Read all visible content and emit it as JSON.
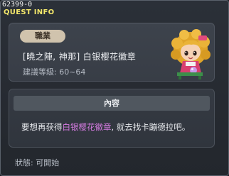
{
  "window": {
    "id_text": "62399-0",
    "title": "QUEST INFO"
  },
  "job": {
    "tag_label": "職業",
    "name": "[曉之陣, 神那] 白银樱花徽章",
    "level_text": "建議等級: 60~64",
    "avatar_icon": "character-avatar-icon"
  },
  "content": {
    "header": "內容",
    "body_prefix": "要想再获得",
    "body_highlight": "白银樱花徽章",
    "body_suffix": ", 就去找卡蹦德拉吧。",
    "highlight_color": "#d47be0"
  },
  "status": {
    "text": "狀態:  可開始"
  }
}
